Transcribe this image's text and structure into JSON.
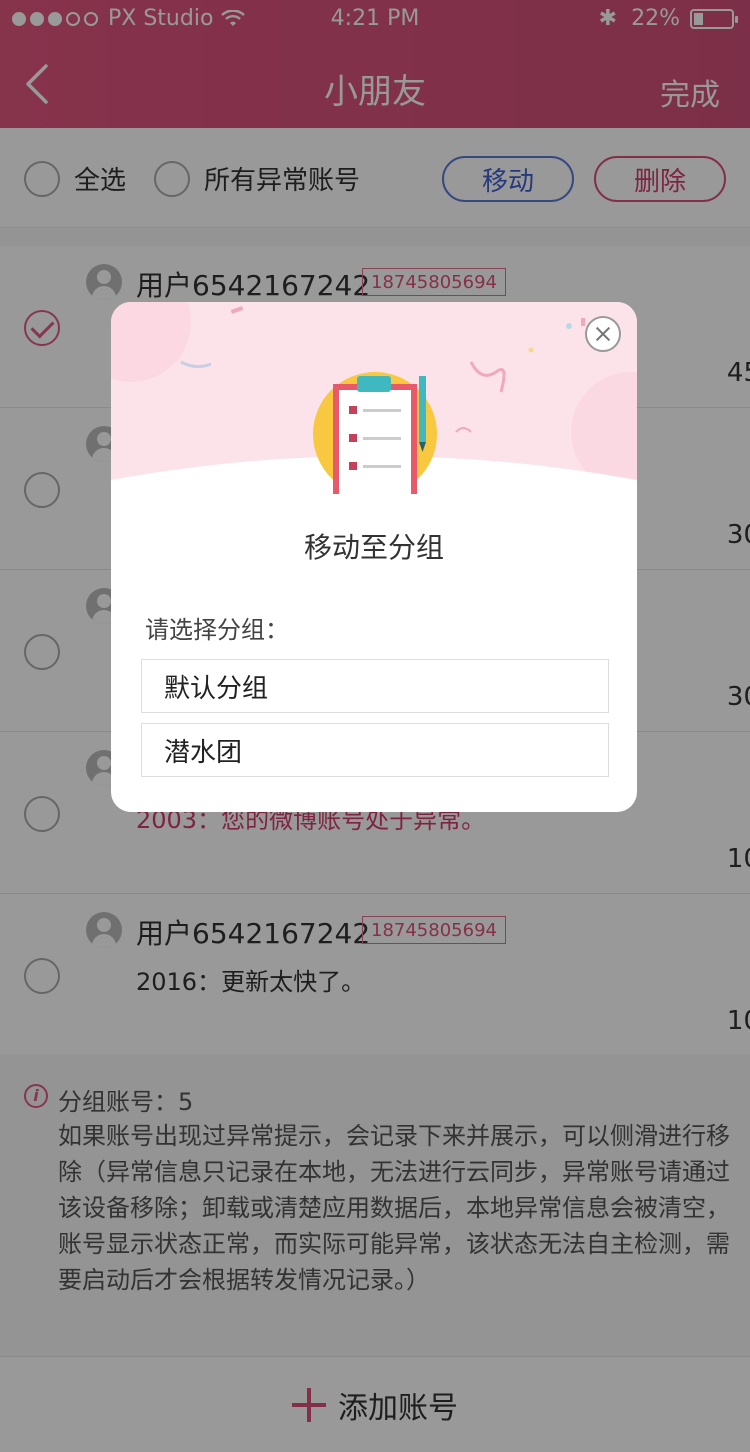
{
  "status_bar": {
    "carrier": "PX Studio",
    "time": "4:21 PM",
    "battery": "22%"
  },
  "nav": {
    "title": "小朋友",
    "done": "完成"
  },
  "toolbar": {
    "select_all": "全选",
    "all_abnormal": "所有异常账号",
    "move": "移动",
    "delete": "删除"
  },
  "list": [
    {
      "user": "用户6542167242",
      "phone": "18745805694",
      "message": "",
      "message_type": "normal",
      "right_num": "45",
      "checked": true
    },
    {
      "user": "",
      "phone": "",
      "message": "",
      "message_type": "normal",
      "right_num": "30",
      "checked": false
    },
    {
      "user": "",
      "phone": "",
      "message": "",
      "message_type": "normal",
      "right_num": "30",
      "checked": false
    },
    {
      "user": "",
      "phone": "",
      "message": "2003：您的微博账号处于异常。",
      "message_type": "error",
      "right_num": "10",
      "checked": false
    },
    {
      "user": "用户6542167242",
      "phone": "18745805694",
      "message": "2016：更新太快了。",
      "message_type": "normal",
      "right_num": "10",
      "checked": false
    }
  ],
  "info": {
    "title": "分组账号：5",
    "text": "如果账号出现过异常提示，会记录下来并展示，可以侧滑进行移除（异常信息只记录在本地，无法进行云同步，异常账号请通过该设备移除；卸载或清楚应用数据后，本地异常信息会被清空，账号显示状态正常，而实际可能异常，该状态无法自主检测，需要启动后才会根据转发情况记录。）"
  },
  "bottom": {
    "add_label": "添加账号"
  },
  "modal": {
    "title": "移动至分组",
    "label": "请选择分组：",
    "options": [
      "默认分组",
      "潜水团"
    ]
  },
  "colors": {
    "brand": "#d94f78",
    "move_blue": "#3f5fd0",
    "overlay": "rgba(0,0,0,0.4)"
  }
}
